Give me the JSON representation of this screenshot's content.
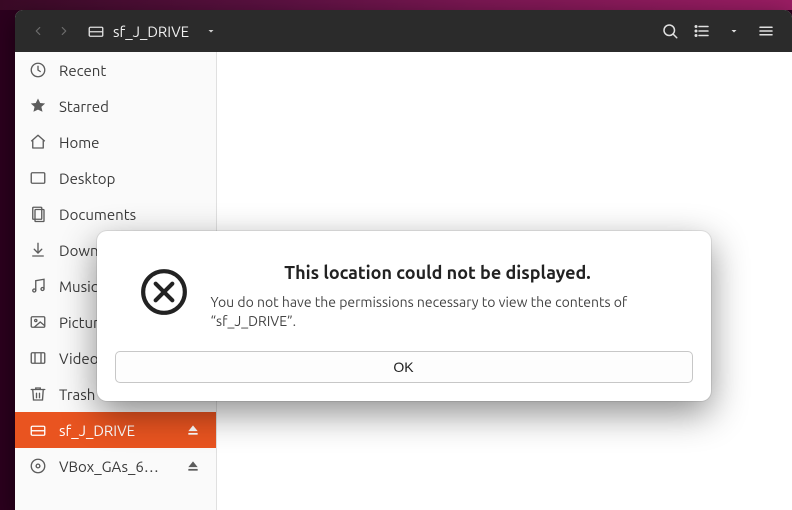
{
  "header": {
    "location_text": "sf_J_DRIVE"
  },
  "sidebar": {
    "items": [
      {
        "label": "Recent",
        "icon": "recent-icon",
        "eject": false,
        "selected": false
      },
      {
        "label": "Starred",
        "icon": "star-icon",
        "eject": false,
        "selected": false
      },
      {
        "label": "Home",
        "icon": "home-icon",
        "eject": false,
        "selected": false
      },
      {
        "label": "Desktop",
        "icon": "desktop-icon",
        "eject": false,
        "selected": false
      },
      {
        "label": "Documents",
        "icon": "documents-icon",
        "eject": false,
        "selected": false
      },
      {
        "label": "Downloads",
        "icon": "downloads-icon",
        "eject": false,
        "selected": false
      },
      {
        "label": "Music",
        "icon": "music-icon",
        "eject": false,
        "selected": false
      },
      {
        "label": "Pictures",
        "icon": "pictures-icon",
        "eject": false,
        "selected": false
      },
      {
        "label": "Videos",
        "icon": "videos-icon",
        "eject": false,
        "selected": false
      },
      {
        "label": "Trash",
        "icon": "trash-icon",
        "eject": false,
        "selected": false
      },
      {
        "label": "sf_J_DRIVE",
        "icon": "drive-icon",
        "eject": true,
        "selected": true
      },
      {
        "label": "VBox_GAs_6…",
        "icon": "disc-icon",
        "eject": true,
        "selected": false
      }
    ]
  },
  "dialog": {
    "title": "This location could not be displayed.",
    "message": "You do not have the permissions necessary to view the contents of “sf_J_DRIVE”.",
    "ok_label": "OK"
  }
}
